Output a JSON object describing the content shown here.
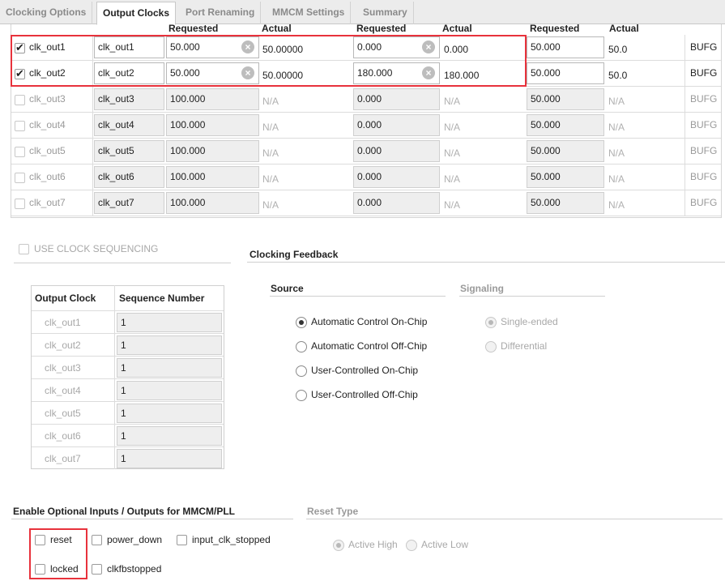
{
  "tabs": [
    "Clocking Options",
    "Output Clocks",
    "Port Renaming",
    "MMCM Settings",
    "Summary"
  ],
  "active_tab": "Output Clocks",
  "output_clocks": {
    "headers": [
      "Requested",
      "Actual",
      "Requested",
      "Actual",
      "Requested",
      "Actual"
    ],
    "rows": [
      {
        "enabled": true,
        "label": "clk_out1",
        "port": "clk_out1",
        "freq_req": "50.000",
        "freq_act": "50.00000",
        "phase_req": "0.000",
        "phase_act": "0.000",
        "duty_req": "50.000",
        "duty_act": "50.0",
        "buffer": "BUFG"
      },
      {
        "enabled": true,
        "label": "clk_out2",
        "port": "clk_out2",
        "freq_req": "50.000",
        "freq_act": "50.00000",
        "phase_req": "180.000",
        "phase_act": "180.000",
        "duty_req": "50.000",
        "duty_act": "50.0",
        "buffer": "BUFG"
      },
      {
        "enabled": false,
        "label": "clk_out3",
        "port": "clk_out3",
        "freq_req": "100.000",
        "freq_act": "N/A",
        "phase_req": "0.000",
        "phase_act": "N/A",
        "duty_req": "50.000",
        "duty_act": "N/A",
        "buffer": "BUFG"
      },
      {
        "enabled": false,
        "label": "clk_out4",
        "port": "clk_out4",
        "freq_req": "100.000",
        "freq_act": "N/A",
        "phase_req": "0.000",
        "phase_act": "N/A",
        "duty_req": "50.000",
        "duty_act": "N/A",
        "buffer": "BUFG"
      },
      {
        "enabled": false,
        "label": "clk_out5",
        "port": "clk_out5",
        "freq_req": "100.000",
        "freq_act": "N/A",
        "phase_req": "0.000",
        "phase_act": "N/A",
        "duty_req": "50.000",
        "duty_act": "N/A",
        "buffer": "BUFG"
      },
      {
        "enabled": false,
        "label": "clk_out6",
        "port": "clk_out6",
        "freq_req": "100.000",
        "freq_act": "N/A",
        "phase_req": "0.000",
        "phase_act": "N/A",
        "duty_req": "50.000",
        "duty_act": "N/A",
        "buffer": "BUFG"
      },
      {
        "enabled": false,
        "label": "clk_out7",
        "port": "clk_out7",
        "freq_req": "100.000",
        "freq_act": "N/A",
        "phase_req": "0.000",
        "phase_act": "N/A",
        "duty_req": "50.000",
        "duty_act": "N/A",
        "buffer": "BUFG"
      }
    ]
  },
  "clock_sequencing": {
    "label": "USE CLOCK SEQUENCING",
    "checked": false,
    "headers": [
      "Output Clock",
      "Sequence Number"
    ],
    "rows": [
      {
        "clock": "clk_out1",
        "seq": "1"
      },
      {
        "clock": "clk_out2",
        "seq": "1"
      },
      {
        "clock": "clk_out3",
        "seq": "1"
      },
      {
        "clock": "clk_out4",
        "seq": "1"
      },
      {
        "clock": "clk_out5",
        "seq": "1"
      },
      {
        "clock": "clk_out6",
        "seq": "1"
      },
      {
        "clock": "clk_out7",
        "seq": "1"
      }
    ]
  },
  "feedback": {
    "title": "Clocking Feedback",
    "source_title": "Source",
    "signaling_title": "Signaling",
    "sources": [
      "Automatic Control On-Chip",
      "Automatic Control Off-Chip",
      "User-Controlled On-Chip",
      "User-Controlled Off-Chip"
    ],
    "selected_source": "Automatic Control On-Chip",
    "signaling": [
      "Single-ended",
      "Differential"
    ],
    "selected_signaling": "Single-ended"
  },
  "optional_io": {
    "title": "Enable Optional Inputs / Outputs for MMCM/PLL",
    "row1": [
      "reset",
      "power_down",
      "input_clk_stopped"
    ],
    "row2": [
      "locked",
      "clkfbstopped"
    ]
  },
  "reset_type": {
    "title": "Reset Type",
    "options": [
      "Active High",
      "Active Low"
    ],
    "selected": "Active High"
  },
  "colors": {
    "highlight": "#e8323c",
    "disabled_field": "#eeeeee",
    "tab_bar": "#ececec"
  }
}
